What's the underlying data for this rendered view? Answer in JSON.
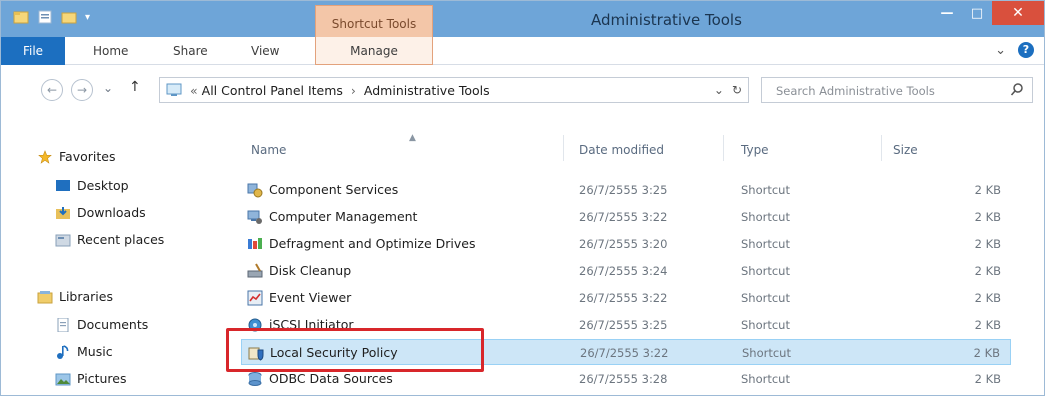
{
  "window": {
    "title": "Administrative Tools",
    "context_tab_group": "Shortcut Tools",
    "close_glyph": "✕",
    "minimize_glyph": "—",
    "maximize_glyph": "□"
  },
  "ribbon": {
    "tabs": [
      {
        "label": "File"
      },
      {
        "label": "Home"
      },
      {
        "label": "Share"
      },
      {
        "label": "View"
      },
      {
        "label": "Manage"
      }
    ],
    "expand_glyph": "⌄",
    "help_glyph": "?"
  },
  "address_bar": {
    "back_glyph": "←",
    "forward_glyph": "→",
    "recent_glyph": "⌄",
    "up_glyph": "↑",
    "path_prefix": "«",
    "breadcrumbs": [
      "All Control Panel Items",
      "Administrative Tools"
    ],
    "separator": "›",
    "dropdown_glyph": "⌄",
    "refresh_glyph": "↻"
  },
  "search": {
    "placeholder": "Search Administrative Tools"
  },
  "nav_pane": {
    "favorites": {
      "label": "Favorites",
      "items": [
        "Desktop",
        "Downloads",
        "Recent places"
      ]
    },
    "libraries": {
      "label": "Libraries",
      "items": [
        "Documents",
        "Music",
        "Pictures"
      ]
    }
  },
  "file_list": {
    "columns": {
      "name": "Name",
      "date": "Date modified",
      "type": "Type",
      "size": "Size"
    },
    "rows": [
      {
        "name": "Component Services",
        "date": "26/7/2555 3:25",
        "type": "Shortcut",
        "size": "2 KB",
        "icon": "component-services-icon"
      },
      {
        "name": "Computer Management",
        "date": "26/7/2555 3:22",
        "type": "Shortcut",
        "size": "2 KB",
        "icon": "computer-management-icon"
      },
      {
        "name": "Defragment and Optimize Drives",
        "date": "26/7/2555 3:20",
        "type": "Shortcut",
        "size": "2 KB",
        "icon": "defragment-icon"
      },
      {
        "name": "Disk Cleanup",
        "date": "26/7/2555 3:24",
        "type": "Shortcut",
        "size": "2 KB",
        "icon": "disk-cleanup-icon"
      },
      {
        "name": "Event Viewer",
        "date": "26/7/2555 3:22",
        "type": "Shortcut",
        "size": "2 KB",
        "icon": "event-viewer-icon"
      },
      {
        "name": "iSCSI Initiator",
        "date": "26/7/2555 3:25",
        "type": "Shortcut",
        "size": "2 KB",
        "icon": "iscsi-icon"
      },
      {
        "name": "Local Security Policy",
        "date": "26/7/2555 3:22",
        "type": "Shortcut",
        "size": "2 KB",
        "icon": "local-security-policy-icon",
        "selected": true
      },
      {
        "name": "ODBC Data Sources",
        "date": "26/7/2555 3:28",
        "type": "Shortcut",
        "size": "2 KB",
        "icon": "odbc-icon"
      }
    ]
  },
  "colors": {
    "titlebar": "#6ea5d8",
    "file_tab": "#1c6fc0",
    "context_tab": "#f3c6a8",
    "selection": "#cde6f7",
    "highlight_box": "#d8262a"
  }
}
